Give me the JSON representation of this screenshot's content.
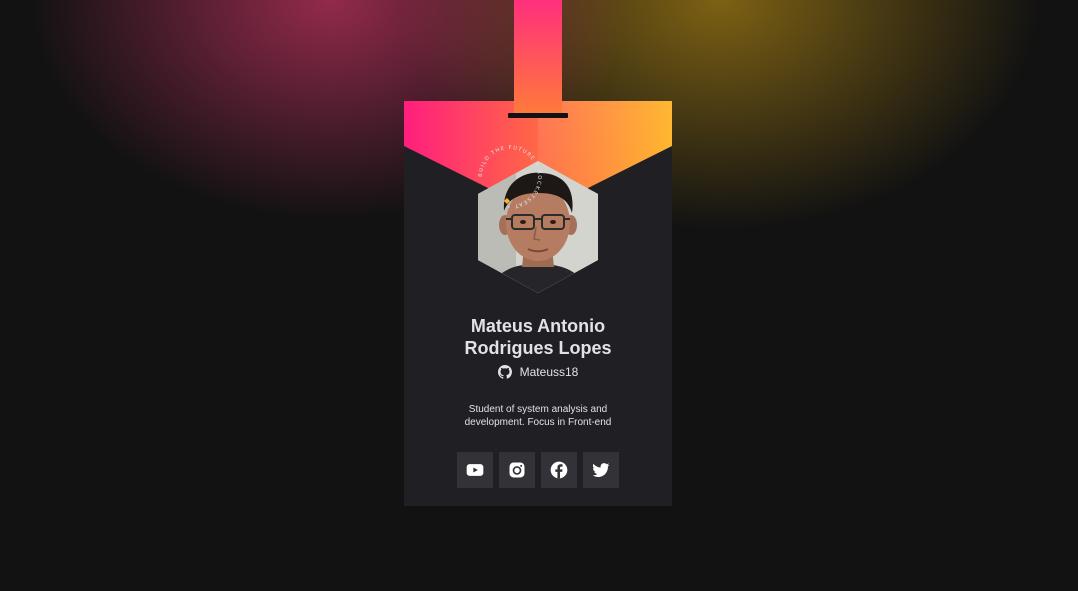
{
  "profile": {
    "name": "Mateus Antonio Rodrigues Lopes",
    "github_user": "Mateuss18",
    "bio": "Student of system analysis and development. Focus in Front-end"
  },
  "seal": {
    "text": "BUILD THE FUTURE • ROCKETSEAT •"
  },
  "socials": [
    {
      "icon": "youtube-icon"
    },
    {
      "icon": "instagram-icon"
    },
    {
      "icon": "facebook-icon"
    },
    {
      "icon": "twitter-icon"
    }
  ],
  "colors": {
    "background": "#121212",
    "card": "#202024",
    "social_bg": "#323238",
    "text": "#e1e1e6",
    "gradient_start": "#ff1e7e",
    "gradient_mid": "#ff6f40",
    "gradient_end": "#ffb52a"
  }
}
